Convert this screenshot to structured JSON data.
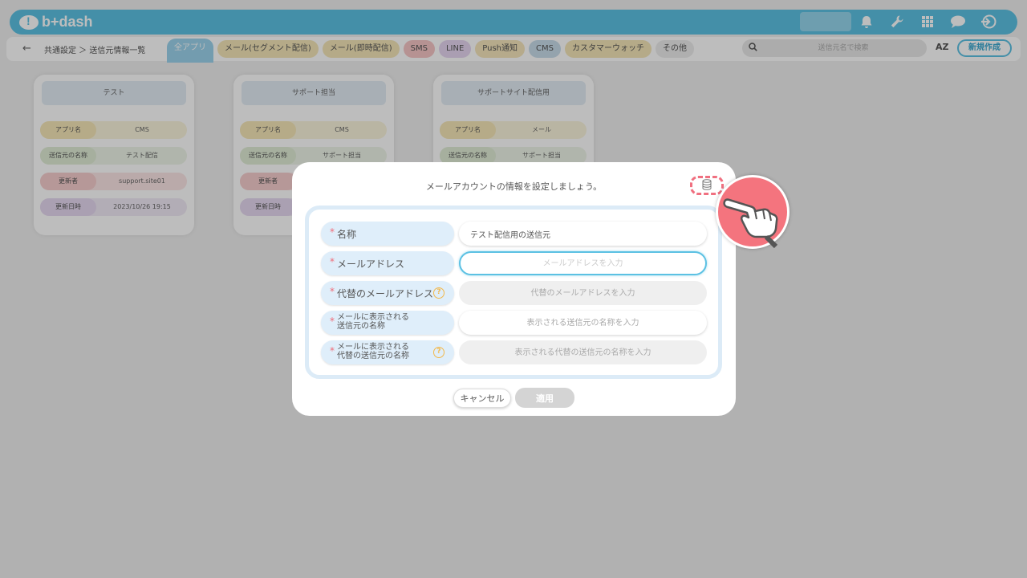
{
  "app": {
    "logo_text": "b+dash",
    "breadcrumb": "共通設定 ＞ 送信元情報一覧",
    "tabs": [
      {
        "label": "全アプリ",
        "color": "#9bd3ec"
      },
      {
        "label": "メール(セグメント配信)",
        "color": "#f4e6b8"
      },
      {
        "label": "メール(即時配信)",
        "color": "#f4e6b8"
      },
      {
        "label": "SMS",
        "color": "#f6c6c6"
      },
      {
        "label": "LINE",
        "color": "#e6d6f0"
      },
      {
        "label": "Push通知",
        "color": "#f6e6bc"
      },
      {
        "label": "CMS",
        "color": "#c8dcea"
      },
      {
        "label": "カスタマーウォッチ",
        "color": "#f4e6b8"
      },
      {
        "label": "その他",
        "color": "#ececec"
      }
    ],
    "search_placeholder": "送信元名で検索",
    "sort_label": "AZ",
    "new_button": "新規作成"
  },
  "cards": [
    {
      "title": "テスト",
      "rows": [
        {
          "key": "アプリ名",
          "value": "CMS",
          "key_color": "#f6e7b8",
          "val_color": "#faf4dc"
        },
        {
          "key": "送信元の名称",
          "value": "テスト配信",
          "key_color": "#e0ecd6",
          "val_color": "#eef5e8"
        },
        {
          "key": "更新者",
          "value": "support.site01",
          "key_color": "#f6cdcd",
          "val_color": "#fbe6e6"
        },
        {
          "key": "更新日時",
          "value": "2023/10/26 19:15",
          "key_color": "#e6d8f0",
          "val_color": "#f1eaf6"
        }
      ]
    },
    {
      "title": "サポート担当",
      "rows": [
        {
          "key": "アプリ名",
          "value": "CMS",
          "key_color": "#f6e7b8",
          "val_color": "#faf4dc"
        },
        {
          "key": "送信元の名称",
          "value": "サポート担当",
          "key_color": "#e0ecd6",
          "val_color": "#eef5e8"
        },
        {
          "key": "更新者",
          "value": "",
          "key_color": "#f6cdcd",
          "val_color": "#fbe6e6"
        },
        {
          "key": "更新日時",
          "value": "",
          "key_color": "#e6d8f0",
          "val_color": "#f1eaf6"
        }
      ]
    },
    {
      "title": "サポートサイト配信用",
      "rows": [
        {
          "key": "アプリ名",
          "value": "メール",
          "key_color": "#f6e7b8",
          "val_color": "#faf4dc"
        },
        {
          "key": "送信元の名称",
          "value": "サポート担当",
          "key_color": "#e0ecd6",
          "val_color": "#eef5e8"
        }
      ]
    }
  ],
  "modal": {
    "title": "メールアカウントの情報を設定しましょう。",
    "fields": [
      {
        "label": "名称",
        "value": "テスト配信用の送信元",
        "placeholder": "",
        "help": false
      },
      {
        "label": "メールアドレス",
        "value": "",
        "placeholder": "メールアドレスを入力",
        "help": false
      },
      {
        "label": "代替のメールアドレス",
        "value": "",
        "placeholder": "代替のメールアドレスを入力",
        "help": true
      },
      {
        "label_line1": "メールに表示される",
        "label_line2": "送信元の名称",
        "value": "",
        "placeholder": "表示される送信元の名称を入力",
        "help": false
      },
      {
        "label_line1": "メールに表示される",
        "label_line2": "代替の送信元の名称",
        "value": "",
        "placeholder": "表示される代替の送信元の名称を入力",
        "help": true
      }
    ],
    "cancel_label": "キャンセル",
    "apply_label": "適用"
  },
  "colors": {
    "accent": "#5cc1e3",
    "required": "#f06d7a",
    "highlight": "#f4747e",
    "help": "#f2b84b"
  }
}
